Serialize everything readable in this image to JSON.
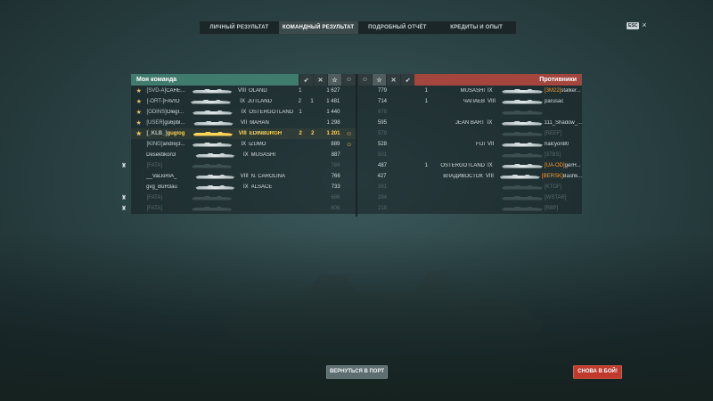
{
  "tabs": [
    {
      "label": "ЛИЧНЫЙ РЕЗУЛЬТАТ",
      "active": false
    },
    {
      "label": "КОМАНДНЫЙ РЕЗУЛЬТАТ",
      "active": true
    },
    {
      "label": "ПОДРОБНЫЙ ОТЧЁТ",
      "active": false
    },
    {
      "label": "КРЕДИТЫ И ОПЫТ",
      "active": false
    }
  ],
  "esc": {
    "key": "ESC",
    "close": "×"
  },
  "team": {
    "title": "Моя команда",
    "sort_icons": [
      "torpedo-icon",
      "cross-icon",
      "star-icon",
      "laurel-icon"
    ],
    "players": [
      {
        "clan": "[SVD-A]",
        "name": "CAHE...",
        "tier": "VIII",
        "ship": "ÖLAND",
        "c1": "1",
        "c2": "",
        "xp": "1 627",
        "emblem": "",
        "badge": "",
        "state": "normal"
      },
      {
        "clan": "[-ORT-]",
        "name": "FAVIO",
        "tier": "IX",
        "ship": "JUTLAND",
        "c1": "2",
        "c2": "1",
        "xp": "1 481",
        "emblem": "",
        "badge": "",
        "state": "normal"
      },
      {
        "clan": "[ODINS]",
        "name": "OlegI...",
        "tier": "IX",
        "ship": "ÖSTERGÖTLAND",
        "c1": "1",
        "c2": "",
        "xp": "1 440",
        "emblem": "",
        "badge": "",
        "state": "normal"
      },
      {
        "clan": "[USER]",
        "name": "gu6pbl...",
        "tier": "VII",
        "ship": "MAHAN",
        "c1": "",
        "c2": "",
        "xp": "1 298",
        "emblem": "",
        "badge": "",
        "state": "normal"
      },
      {
        "clan": "[_KLB_]",
        "name": "guglog",
        "tier": "VIII",
        "ship": "EDINBURGH",
        "c1": "2",
        "c2": "2",
        "xp": "1 201",
        "emblem": "☺",
        "badge": "",
        "state": "highlight"
      },
      {
        "clan": "[KING]",
        "name": "andrej3...",
        "tier": "IX",
        "ship": "IZUMO",
        "c1": "",
        "c2": "",
        "xp": "889",
        "emblem": "☺",
        "badge": "",
        "state": "normal"
      },
      {
        "clan": "",
        "name": "Desektikon3",
        "tier": "IX",
        "ship": "MUSASHI",
        "c1": "",
        "c2": "",
        "xp": "887",
        "emblem": "",
        "badge": "",
        "state": "normal"
      },
      {
        "clan": "[FATA]",
        "name": "",
        "tier": "",
        "ship": "",
        "c1": "",
        "c2": "",
        "xp": "784",
        "emblem": "",
        "badge": "♜",
        "state": "dead"
      },
      {
        "clan": "",
        "name": "__VaLkiRiA_",
        "tier": "VIII",
        "ship": "N. CAROLINA",
        "c1": "",
        "c2": "",
        "xp": "766",
        "emblem": "",
        "badge": "",
        "state": "normal"
      },
      {
        "clan": "",
        "name": "gvg_BuH3au",
        "tier": "IX",
        "ship": "ALSACE",
        "c1": "",
        "c2": "",
        "xp": "733",
        "emblem": "",
        "badge": "",
        "state": "normal"
      },
      {
        "clan": "[FATA]",
        "name": "",
        "tier": "",
        "ship": "",
        "c1": "",
        "c2": "",
        "xp": "686",
        "emblem": "",
        "badge": "♜",
        "state": "dead"
      },
      {
        "clan": "[FATA]",
        "name": "",
        "tier": "",
        "ship": "",
        "c1": "",
        "c2": "",
        "xp": "608",
        "emblem": "",
        "badge": "♜",
        "state": "dead"
      }
    ]
  },
  "enemy": {
    "title": "Противники",
    "sort_icons": [
      "laurel-icon",
      "star-icon",
      "cross-icon",
      "torpedo-icon"
    ],
    "players": [
      {
        "clan": "[3M22]",
        "name": "stalker...",
        "tier": "IX",
        "ship": "MUSASHI",
        "c1": "1",
        "c2": "",
        "xp": "779",
        "state": "normal"
      },
      {
        "clan": "",
        "name": "parusac",
        "tier": "VIII",
        "ship": "ЧАПАЕВ",
        "c1": "1",
        "c2": "",
        "xp": "714",
        "state": "normal"
      },
      {
        "clan": "",
        "name": "",
        "tier": "",
        "ship": "",
        "c1": "",
        "c2": "",
        "xp": "678",
        "state": "dead"
      },
      {
        "clan": "",
        "name": "111_Shadow_...",
        "tier": "IX",
        "ship": "JEAN BART",
        "c1": "",
        "c2": "",
        "xp": "595",
        "state": "normal"
      },
      {
        "clan": "[REEF]",
        "name": "",
        "tier": "",
        "ship": "",
        "c1": "",
        "c2": "",
        "xp": "579",
        "state": "dead"
      },
      {
        "clan": "",
        "name": "halcyon80",
        "tier": "VII",
        "ship": "FIJI",
        "c1": "",
        "c2": "",
        "xp": "528",
        "state": "normal"
      },
      {
        "clan": "[37BS]",
        "name": "",
        "tier": "",
        "ship": "",
        "c1": "",
        "c2": "",
        "xp": "501",
        "state": "dead"
      },
      {
        "clan": "[UA-OD]",
        "name": "gerH...",
        "tier": "IX",
        "ship": "ÖSTERGÖTLAND",
        "c1": "1",
        "c2": "",
        "xp": "487",
        "state": "normal"
      },
      {
        "clan": "[BERSK]",
        "name": "Bashk...",
        "tier": "VIII",
        "ship": "ВЛАДИВОСТОК",
        "c1": "",
        "c2": "",
        "xp": "427",
        "state": "normal"
      },
      {
        "clan": "[KTOF]",
        "name": "",
        "tier": "",
        "ship": "",
        "c1": "",
        "c2": "",
        "xp": "391",
        "state": "dead"
      },
      {
        "clan": "[WSTAR]",
        "name": "",
        "tier": "",
        "ship": "",
        "c1": "",
        "c2": "",
        "xp": "284",
        "state": "dead"
      },
      {
        "clan": "[R8P]",
        "name": "",
        "tier": "",
        "ship": "",
        "c1": "",
        "c2": "",
        "xp": "218",
        "state": "dead"
      }
    ]
  },
  "buttons": {
    "port": "ВЕРНУТЬСЯ В ПОРТ",
    "battle": "СНОВА В БОЙ!"
  }
}
